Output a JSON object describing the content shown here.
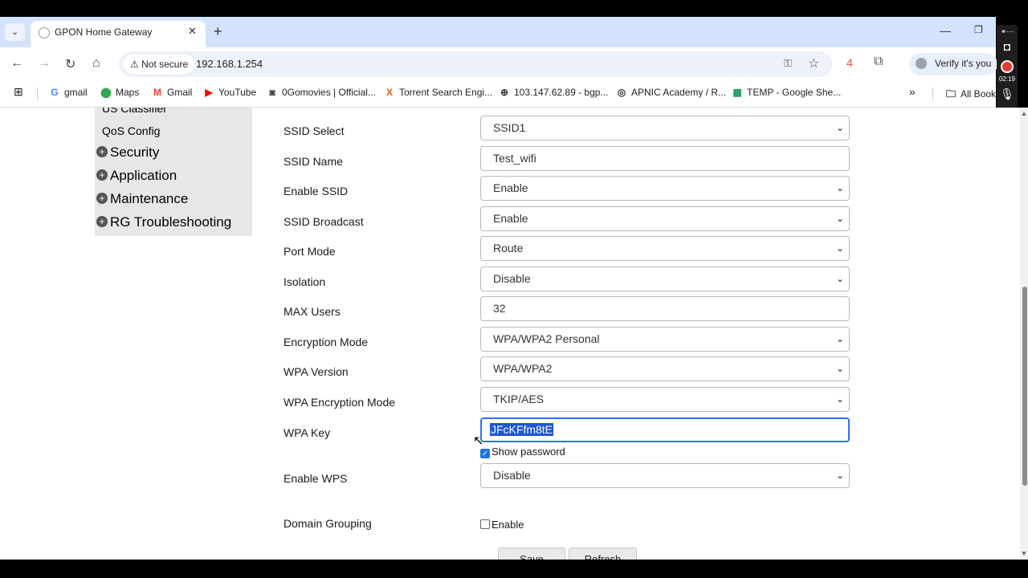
{
  "browser": {
    "tab_title": "GPON Home Gateway",
    "not_secure": "Not secure",
    "url": "192.168.1.254",
    "extension_count": "4",
    "profile": "Verify it's you",
    "bookmarks": [
      {
        "label": "gmail",
        "icon": "google-icon"
      },
      {
        "label": "Maps",
        "icon": "maps-icon"
      },
      {
        "label": "Gmail",
        "icon": "gmail-icon"
      },
      {
        "label": "YouTube",
        "icon": "youtube-icon"
      },
      {
        "label": "0Gomovies | Official...",
        "icon": "site-icon"
      },
      {
        "label": "Torrent Search Engi...",
        "icon": "x-icon"
      },
      {
        "label": "103.147.62.89 - bgp...",
        "icon": "globe-icon"
      },
      {
        "label": "APNIC Academy / R...",
        "icon": "apnic-icon"
      },
      {
        "label": "TEMP - Google She...",
        "icon": "sheets-icon"
      }
    ],
    "all_bookmarks": "All Bookm"
  },
  "recorder": {
    "time": "02:19"
  },
  "menu": {
    "classifier": "US Classifier",
    "qos": "QoS Config",
    "top_items": [
      "Security",
      "Application",
      "Maintenance",
      "RG Troubleshooting"
    ]
  },
  "form": {
    "ssid_select": {
      "label": "SSID Select",
      "value": "SSID1"
    },
    "ssid_name": {
      "label": "SSID Name",
      "value": "Test_wifi"
    },
    "enable_ssid": {
      "label": "Enable SSID",
      "value": "Enable"
    },
    "ssid_broadcast": {
      "label": "SSID Broadcast",
      "value": "Enable"
    },
    "port_mode": {
      "label": "Port Mode",
      "value": "Route"
    },
    "isolation": {
      "label": "Isolation",
      "value": "Disable"
    },
    "max_users": {
      "label": "MAX Users",
      "value": "32"
    },
    "encryption_mode": {
      "label": "Encryption Mode",
      "value": "WPA/WPA2 Personal"
    },
    "wpa_version": {
      "label": "WPA Version",
      "value": "WPA/WPA2"
    },
    "wpa_encryption_mode": {
      "label": "WPA Encryption Mode",
      "value": "TKIP/AES"
    },
    "wpa_key": {
      "label": "WPA Key",
      "value": "JFcKFfm8tE"
    },
    "show_password": {
      "label": "Show password",
      "checked": true
    },
    "enable_wps": {
      "label": "Enable WPS",
      "value": "Disable"
    },
    "domain_grouping": {
      "label": "Domain Grouping",
      "checkbox_label": "Enable",
      "checked": false
    },
    "save_button": "Save",
    "refresh_button": "Refresh"
  }
}
